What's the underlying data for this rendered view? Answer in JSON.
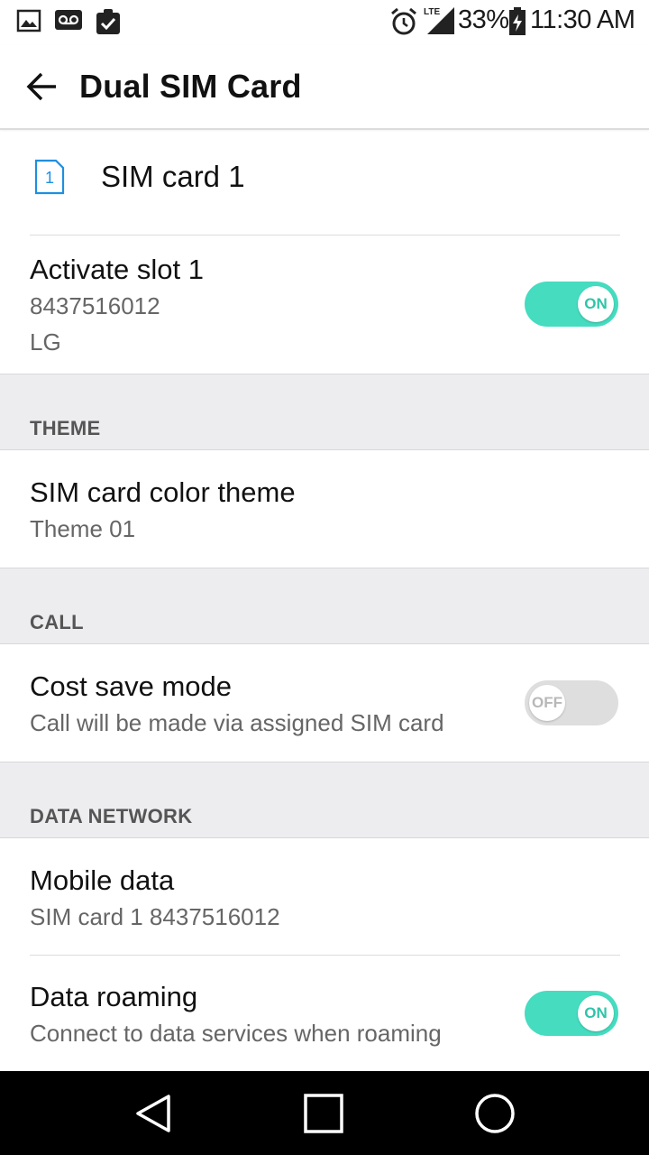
{
  "status_bar": {
    "icons": [
      "image-icon",
      "voicemail-icon",
      "clipboard-check-icon",
      "alarm-icon",
      "lte-signal-icon",
      "battery-charging-icon"
    ],
    "network": "LTE",
    "battery": "33%",
    "time": "11:30 AM"
  },
  "appbar": {
    "title": "Dual SIM Card"
  },
  "sim_header": {
    "number": "1",
    "label": "SIM card 1",
    "accent": "#1f8fe0"
  },
  "activate_slot": {
    "title": "Activate slot 1",
    "number": "8437516012",
    "carrier": "LG",
    "toggle": "ON"
  },
  "sections": {
    "theme": "THEME",
    "call": "CALL",
    "data_network": "DATA NETWORK"
  },
  "color_theme": {
    "title": "SIM card color theme",
    "value": "Theme 01"
  },
  "cost_save": {
    "title": "Cost save mode",
    "subtitle": "Call will be made via assigned SIM card",
    "toggle": "OFF"
  },
  "mobile_data": {
    "title": "Mobile data",
    "subtitle": "SIM card 1 8437516012"
  },
  "data_roaming": {
    "title": "Data roaming",
    "subtitle": "Connect to data services when roaming",
    "toggle": "ON"
  },
  "colors": {
    "toggle_on": "#45dcc0",
    "toggle_off": "#dedede",
    "section_bg": "#ededf0"
  },
  "navbar": {
    "icons": [
      "back-triangle-icon",
      "home-circle-icon",
      "recents-square-icon"
    ]
  }
}
